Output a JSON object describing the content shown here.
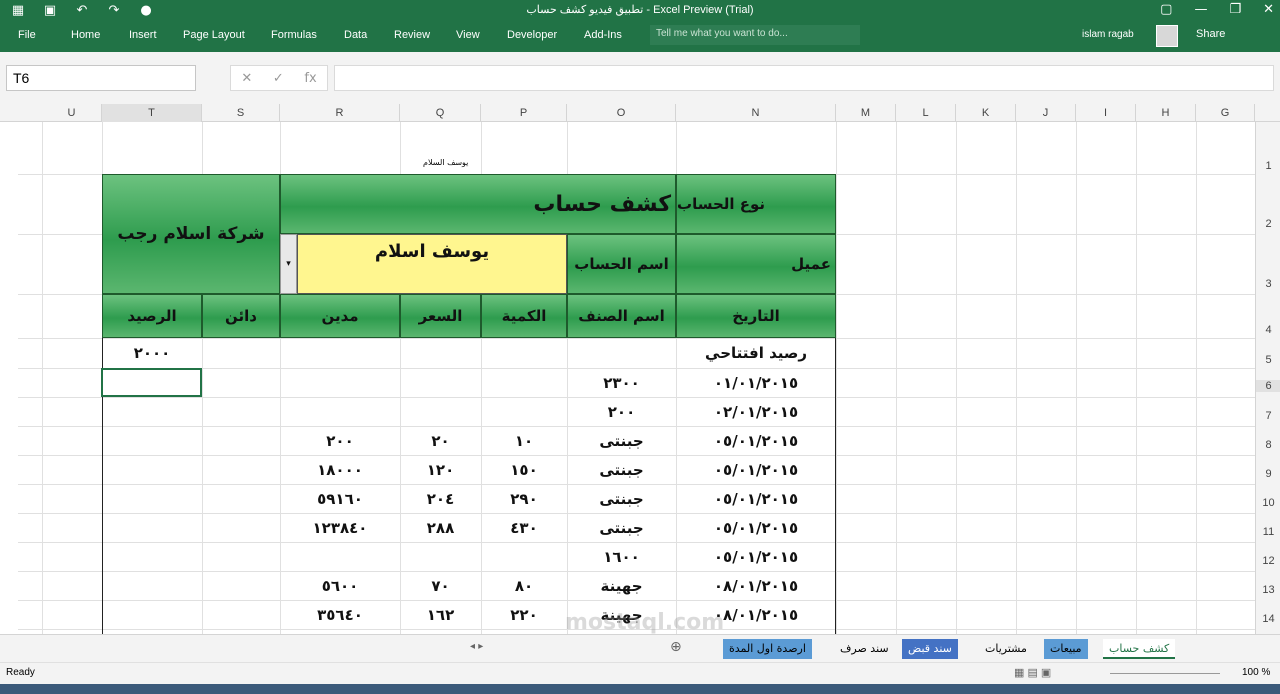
{
  "window": {
    "title": "تطبيق فيديو كشف حساب - Excel Preview (Trial)",
    "qat_icons": [
      "save-icon",
      "undo-icon",
      "redo-icon",
      "touch-icon",
      "customize-icon"
    ]
  },
  "ribbon": {
    "tabs": [
      "File",
      "Home",
      "Insert",
      "Page Layout",
      "Formulas",
      "Data",
      "Review",
      "View",
      "Developer",
      "Add-Ins"
    ],
    "tellme_placeholder": "Tell me what you want to do...",
    "user": "islam ragab",
    "share": "Share"
  },
  "formula_bar": {
    "name_box": "T6",
    "fx": "fx",
    "value": ""
  },
  "columns": [
    "U",
    "T",
    "S",
    "R",
    "Q",
    "P",
    "O",
    "N",
    "M",
    "L",
    "K",
    "J",
    "I",
    "H",
    "G"
  ],
  "rows": [
    "1",
    "2",
    "3",
    "4",
    "5",
    "6",
    "7",
    "8",
    "9",
    "10",
    "11",
    "12",
    "13",
    "14"
  ],
  "sheet": {
    "small_label": "يوسف السلام",
    "account_type_label": "نوع الحساب",
    "account_type_value": "عميل",
    "statement_title": "كشف حساب",
    "company": "شركة اسلام رجب",
    "account_name_label": "اسم الحساب",
    "account_name_value": "يوسف اسلام",
    "headers": {
      "date": "التاريخ",
      "item": "اسم الصنف",
      "qty": "الكمية",
      "price": "السعر",
      "debit": "مدين",
      "credit": "دائن",
      "balance": "الرصيد"
    },
    "opening_label": "رصيد افتتاحي",
    "opening_balance": "٢٠٠٠",
    "data_rows": [
      {
        "date": "٠١/٠١/٢٠١٥",
        "item": "٢٣٠٠",
        "qty": "",
        "price": "",
        "debit": ""
      },
      {
        "date": "٠٢/٠١/٢٠١٥",
        "item": "٢٠٠",
        "qty": "",
        "price": "",
        "debit": ""
      },
      {
        "date": "٠٥/٠١/٢٠١٥",
        "item": "جبنتى",
        "qty": "١٠",
        "price": "٢٠",
        "debit": "٢٠٠"
      },
      {
        "date": "٠٥/٠١/٢٠١٥",
        "item": "جبنتى",
        "qty": "١٥٠",
        "price": "١٢٠",
        "debit": "١٨٠٠٠"
      },
      {
        "date": "٠٥/٠١/٢٠١٥",
        "item": "جبنتى",
        "qty": "٢٩٠",
        "price": "٢٠٤",
        "debit": "٥٩١٦٠"
      },
      {
        "date": "٠٥/٠١/٢٠١٥",
        "item": "جبنتى",
        "qty": "٤٣٠",
        "price": "٢٨٨",
        "debit": "١٢٣٨٤٠"
      },
      {
        "date": "٠٥/٠١/٢٠١٥",
        "item": "١٦٠٠",
        "qty": "",
        "price": "",
        "debit": ""
      },
      {
        "date": "٠٨/٠١/٢٠١٥",
        "item": "جهينة",
        "qty": "٨٠",
        "price": "٧٠",
        "debit": "٥٦٠٠"
      },
      {
        "date": "٠٨/٠١/٢٠١٥",
        "item": "جهينة",
        "qty": "٢٢٠",
        "price": "١٦٢",
        "debit": "٣٥٦٤٠"
      }
    ]
  },
  "sheet_tabs": [
    {
      "label": "كشف حساب",
      "color": "#ffffff",
      "active": true
    },
    {
      "label": "مبيعات",
      "color": "#5b9bd5"
    },
    {
      "label": "مشتريات",
      "color": "#f3f3f3"
    },
    {
      "label": "سند قبض",
      "color": "#4472c4"
    },
    {
      "label": "سند صرف",
      "color": "#f3f3f3"
    },
    {
      "label": "ارصدة اول المدة",
      "color": "#5b9bd5"
    }
  ],
  "status": {
    "ready": "Ready",
    "zoom": "100 %"
  },
  "watermark": "mostaql.com"
}
